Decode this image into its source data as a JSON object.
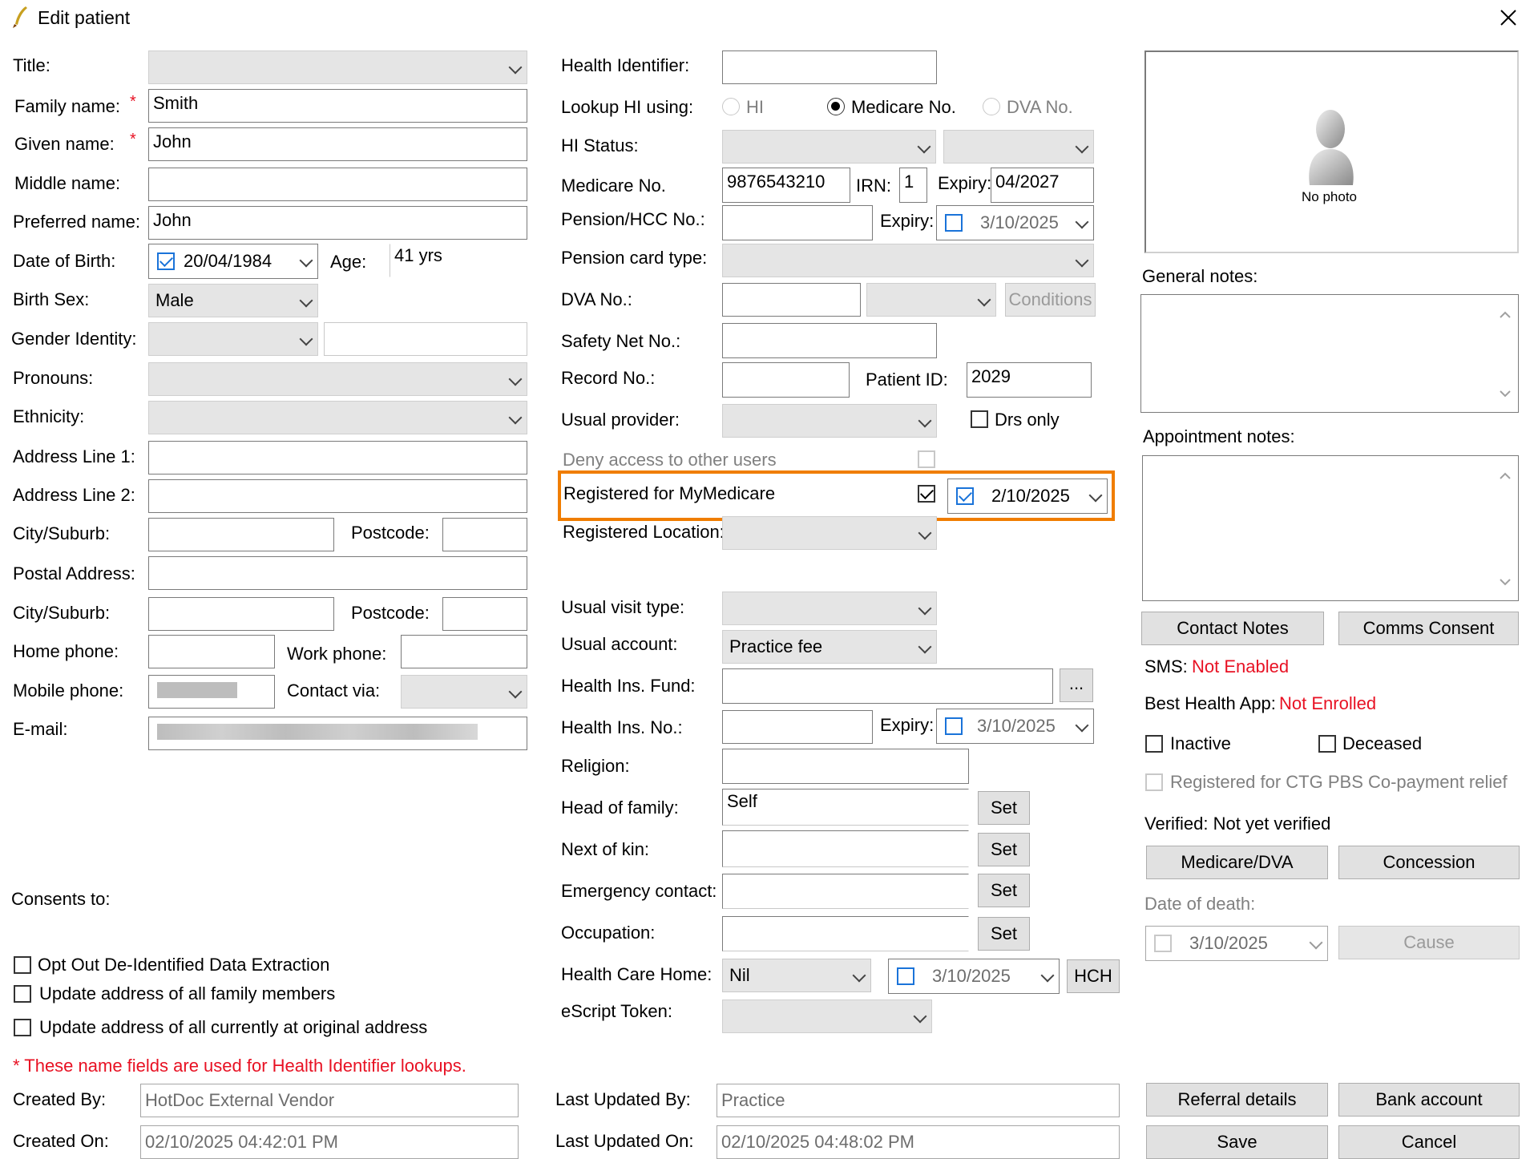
{
  "window": {
    "title": "Edit patient",
    "close_icon": "close-icon",
    "app_icon": "quill-icon"
  },
  "left": {
    "title_label": "Title:",
    "family_name_label": "Family name:",
    "family_name": "Smith",
    "given_name_label": "Given name:",
    "given_name": "John",
    "middle_name_label": "Middle name:",
    "preferred_name_label": "Preferred name:",
    "preferred_name": "John",
    "dob_label": "Date of Birth:",
    "dob": "20/04/1984",
    "age_label": "Age:",
    "age": "41 yrs",
    "birth_sex_label": "Birth Sex:",
    "birth_sex": "Male",
    "gender_identity_label": "Gender Identity:",
    "pronouns_label": "Pronouns:",
    "ethnicity_label": "Ethnicity:",
    "address1_label": "Address Line 1:",
    "address2_label": "Address Line 2:",
    "city_label": "City/Suburb:",
    "postcode_label": "Postcode:",
    "postal_label": "Postal Address:",
    "city2_label": "City/Suburb:",
    "postcode2_label": "Postcode:",
    "home_phone_label": "Home phone:",
    "work_phone_label": "Work phone:",
    "mobile_label": "Mobile phone:",
    "contact_via_label": "Contact via:",
    "email_label": "E-mail:",
    "consents_label": "Consents to:",
    "opt_out": "Opt Out De-Identified Data Extraction",
    "update_family": "Update address of all family members",
    "update_original": "Update address of all currently at original address",
    "required_note": "* These name fields are used for Health Identifier lookups.",
    "required_marker": "*"
  },
  "middle": {
    "hi_label": "Health Identifier:",
    "lookup_label": "Lookup HI using:",
    "radio_hi": "HI",
    "radio_medicare": "Medicare No.",
    "radio_dva": "DVA No.",
    "hi_status_label": "HI Status:",
    "medicare_label": "Medicare No.",
    "medicare_no": "9876543210",
    "irn_label": "IRN:",
    "irn": "1",
    "expiry_label": "Expiry:",
    "medicare_expiry": "04/2027",
    "pension_label": "Pension/HCC No.:",
    "pension_expiry": "3/10/2025",
    "pension_type_label": "Pension card type:",
    "dva_label": "DVA No.:",
    "conditions": "Conditions",
    "safety_label": "Safety Net No.:",
    "record_label": "Record No.:",
    "patient_id_label": "Patient ID:",
    "patient_id": "2029",
    "usual_provider_label": "Usual provider:",
    "drs_only": "Drs only",
    "deny_access": "Deny access to other users",
    "mymedicare_label": "Registered for MyMedicare",
    "mymedicare_date": "2/10/2025",
    "reg_location_label": "Registered Location:",
    "visit_type_label": "Usual visit type:",
    "account_label": "Usual account:",
    "account": "Practice fee",
    "fund_label": "Health Ins. Fund:",
    "fund_button": "...",
    "ins_no_label": "Health Ins. No.:",
    "ins_expiry": "3/10/2025",
    "religion_label": "Religion:",
    "head_label": "Head of family:",
    "head": "Self",
    "kin_label": "Next of kin:",
    "emergency_label": "Emergency contact:",
    "occupation_label": "Occupation:",
    "set": "Set",
    "hch_label": "Health Care Home:",
    "hch_value": "Nil",
    "hch_date": "3/10/2025",
    "hch_button": "HCH",
    "escript_label": "eScript Token:"
  },
  "right": {
    "no_photo": "No photo",
    "general_notes_label": "General notes:",
    "appt_notes_label": "Appointment notes:",
    "contact_notes": "Contact Notes",
    "comms_consent": "Comms Consent",
    "sms_label": "SMS:",
    "sms_status": "Not Enabled",
    "bha_label": "Best Health App:",
    "bha_status": "Not Enrolled",
    "inactive": "Inactive",
    "deceased": "Deceased",
    "ctg": "Registered for CTG PBS Co-payment relief",
    "verified": "Verified: Not yet verified",
    "medicare_dva": "Medicare/DVA",
    "concession": "Concession",
    "dod_label": "Date of death:",
    "dod": "3/10/2025",
    "cause": "Cause",
    "referral": "Referral details",
    "bank": "Bank account",
    "save": "Save",
    "cancel": "Cancel"
  },
  "footer": {
    "created_by_label": "Created By:",
    "created_by": "HotDoc External Vendor",
    "created_on_label": "Created On:",
    "created_on": "02/10/2025 04:42:01 PM",
    "updated_by_label": "Last Updated By:",
    "updated_by": "Practice",
    "updated_on_label": "Last Updated On:",
    "updated_on": "02/10/2025 04:48:02 PM"
  },
  "colors": {
    "highlight": "#f07d00",
    "required": "#e81123",
    "check_blue": "#1a73d9"
  }
}
